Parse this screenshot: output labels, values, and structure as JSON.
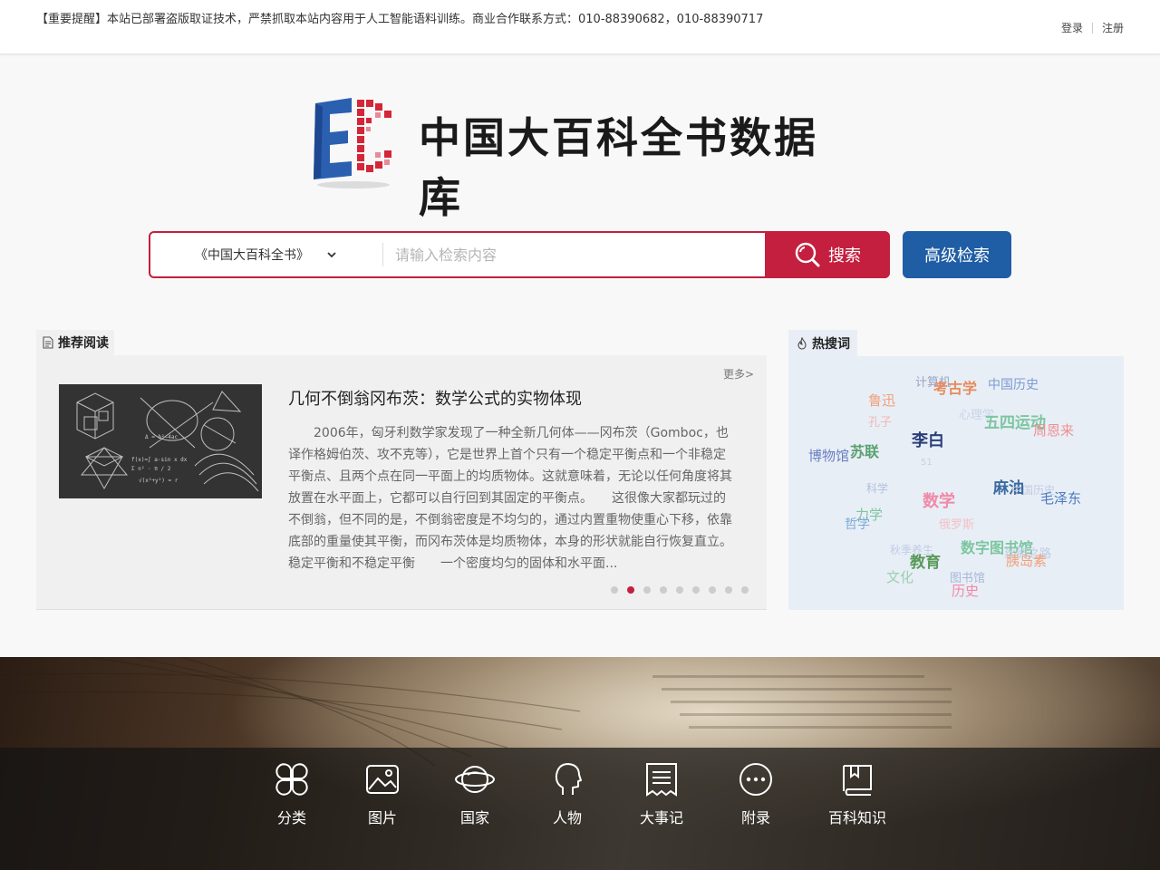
{
  "notice": "【重要提醒】本站已部署盗版取证技术，严禁抓取本站内容用于人工智能语料训练。商业合作联系方式：010-88390682，010-88390717",
  "auth": {
    "login": "登录",
    "register": "注册"
  },
  "logo": {
    "text": "中国大百科全书数据库"
  },
  "search": {
    "scope": "《中国大百科全书》",
    "placeholder": "请输入检索内容",
    "button": "搜索",
    "advanced": "高级检索"
  },
  "recommend": {
    "tab": "推荐阅读",
    "more": "更多>",
    "title": "几何不倒翁冈布茨：数学公式的实物体现",
    "body": "2006年，匈牙利数学家发现了一种全新几何体——冈布茨（Gomboc，也译作格姆伯茨、攻不克等），它是世界上首个只有一个稳定平衡点和一个非稳定平衡点、且两个点在同一平面上的均质物体。这就意味着，无论以任何角度将其放置在水平面上，它都可以自行回到其固定的平衡点。　　这很像大家都玩过的不倒翁，但不同的是，不倒翁密度是不均匀的，通过内置重物使重心下移，依靠底部的重量使其平衡，而冈布茨体是均质物体，本身的形状就能自行恢复直立。　稳定平衡和不稳定平衡　　一个密度均匀的固体和水平面...",
    "dots": 9,
    "active_dot": 1
  },
  "hot": {
    "tab": "热搜词",
    "words": [
      {
        "text": "计算机",
        "color": "#9aa6c4",
        "size": 13
      },
      {
        "text": "考古学",
        "color": "#e88a5a",
        "size": 16
      },
      {
        "text": "中国历史",
        "color": "#7d9bd0",
        "size": 14
      },
      {
        "text": "鲁迅",
        "color": "#f0a07a",
        "size": 15
      },
      {
        "text": "心理学",
        "color": "#c8d3e8",
        "size": 13
      },
      {
        "text": "五四运动",
        "color": "#7cc6a0",
        "size": 17
      },
      {
        "text": "孔子",
        "color": "#f2b8b8",
        "size": 13
      },
      {
        "text": "周恩来",
        "color": "#f09090",
        "size": 15
      },
      {
        "text": "李白",
        "color": "#2a3f7a",
        "size": 18
      },
      {
        "text": "苏联",
        "color": "#5aa070",
        "size": 16
      },
      {
        "text": "博物馆",
        "color": "#6a7fc0",
        "size": 15
      },
      {
        "text": "51",
        "color": "#c8d0e0",
        "size": 10
      },
      {
        "text": "麻油",
        "color": "#3a6aa0",
        "size": 17
      },
      {
        "text": "科学",
        "color": "#b0c0dc",
        "size": 12
      },
      {
        "text": "中国历史",
        "color": "#c0cce4",
        "size": 12
      },
      {
        "text": "毛泽东",
        "color": "#4a7abf",
        "size": 15
      },
      {
        "text": "数学",
        "color": "#f08aa8",
        "size": 18
      },
      {
        "text": "力学",
        "color": "#7cc6a0",
        "size": 15
      },
      {
        "text": "哲学",
        "color": "#7aaad8",
        "size": 14
      },
      {
        "text": "俄罗斯",
        "color": "#f4c0c8",
        "size": 13
      },
      {
        "text": "数字图书馆",
        "color": "#7cc6a0",
        "size": 16
      },
      {
        "text": "秋季养生",
        "color": "#c0cce4",
        "size": 12
      },
      {
        "text": "丝绸之路",
        "color": "#c0cce4",
        "size": 13
      },
      {
        "text": "教育",
        "color": "#5a9a5a",
        "size": 17
      },
      {
        "text": "胰岛素",
        "color": "#f0a07a",
        "size": 15
      },
      {
        "text": "文化",
        "color": "#9ad0b0",
        "size": 15
      },
      {
        "text": "图书馆",
        "color": "#a8b8d8",
        "size": 13
      },
      {
        "text": "历史",
        "color": "#f08aa8",
        "size": 15
      }
    ]
  },
  "nav": [
    {
      "label": "分类",
      "icon": "category-icon"
    },
    {
      "label": "图片",
      "icon": "image-icon"
    },
    {
      "label": "国家",
      "icon": "planet-icon"
    },
    {
      "label": "人物",
      "icon": "person-head-icon"
    },
    {
      "label": "大事记",
      "icon": "document-icon"
    },
    {
      "label": "附录",
      "icon": "more-icon"
    },
    {
      "label": "百科知识",
      "icon": "book-icon"
    }
  ]
}
